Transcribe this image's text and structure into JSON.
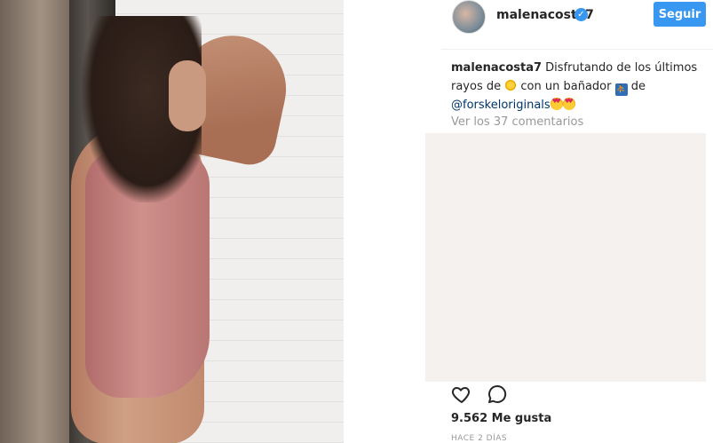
{
  "post": {
    "username": "malenacosta7",
    "follow_label": "Seguir",
    "verified_icon": "verified-badge-icon",
    "caption": {
      "user": "malenacosta7",
      "part1": "Disfrutando de los últimos rayos de",
      "part2": "con un bañador",
      "part3": "de",
      "mention": "@forskeloriginals"
    },
    "view_comments": "Ver los 37 comentarios",
    "likes": "9.562 Me gusta",
    "timestamp": "HACE 2 DÍAS"
  },
  "icons": {
    "like": "heart-icon",
    "comment": "comment-icon"
  },
  "colors": {
    "accent": "#3897f0",
    "text": "#262626",
    "muted": "#999999",
    "mention": "#003569"
  }
}
